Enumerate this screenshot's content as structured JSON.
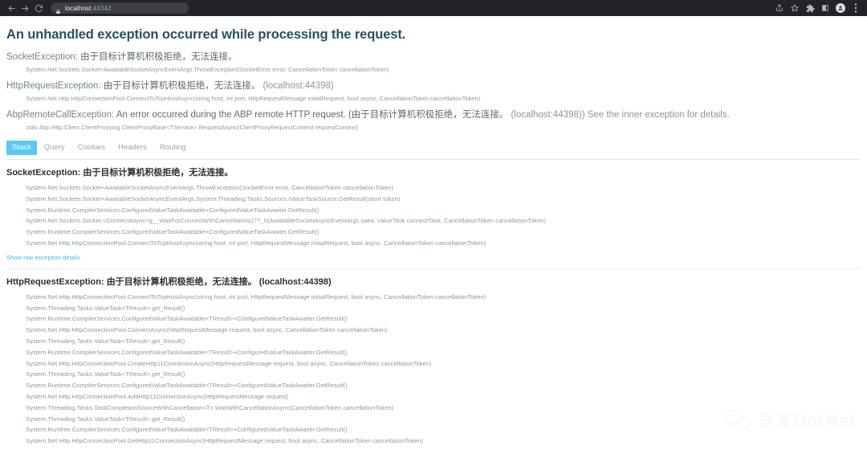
{
  "browser": {
    "back_icon": "arrow-left-icon",
    "forward_icon": "arrow-right-icon",
    "reload_icon": "reload-icon",
    "lock_icon": "lock-icon",
    "url_host": "localhost",
    "url_port": ":44342",
    "right_icons": [
      "share-icon",
      "bookmark-star-icon",
      "extensions-puzzle-icon",
      "side-panel-icon",
      "profile-avatar-icon",
      "browser-menu-icon"
    ]
  },
  "page": {
    "title": "An unhandled exception occurred while processing the request.",
    "summary": [
      {
        "heading_type": "SocketException: ",
        "heading_message": "由于目标计算机积极拒绝，无法连接。",
        "heading_location": "",
        "frame": "System.Net.Sockets.Socket+AwaitableSocketAsyncEventArgs.ThrowException(SocketError error, CancellationToken cancellationToken)"
      },
      {
        "heading_type": "HttpRequestException: ",
        "heading_message": "由于目标计算机积极拒绝，无法连接。",
        "heading_location": " (localhost:44398)",
        "frame": "System.Net.Http.HttpConnectionPool.ConnectToTcpHostAsync(string host, int port, HttpRequestMessage initialRequest, bool async, CancellationToken cancellationToken)"
      },
      {
        "heading_type": "AbpRemoteCallException: ",
        "heading_message": "An error occurred during the ABP remote HTTP request. (由于目标计算机积极拒绝，无法连接。",
        "heading_location": " (localhost:44398)) See the inner exception for details.",
        "frame": "Volo.Abp.Http.Client.ClientProxying.ClientProxyBase<TService>.RequestAsync(ClientProxyRequestContext requestContext)"
      }
    ],
    "tabs": [
      {
        "label": "Stack",
        "active": true
      },
      {
        "label": "Query",
        "active": false
      },
      {
        "label": "Cookies",
        "active": false
      },
      {
        "label": "Headers",
        "active": false
      },
      {
        "label": "Routing",
        "active": false
      }
    ],
    "raw_details_link": "Show raw exception details",
    "exceptions": [
      {
        "type": "SocketException: ",
        "message": "由于目标计算机积极拒绝，无法连接。",
        "location": "",
        "frames": [
          "System.Net.Sockets.Socket+AwaitableSocketAsyncEventArgs.ThrowException(SocketError error, CancellationToken cancellationToken)",
          "System.Net.Sockets.Socket+AwaitableSocketAsyncEventArgs.System.Threading.Tasks.Sources.IValueTaskSource.GetResult(short token)",
          "System.Runtime.CompilerServices.ConfiguredValueTaskAwaitable+ConfiguredValueTaskAwaiter.GetResult()",
          "System.Net.Sockets.Socket.<ConnectAsync>g__WaitForConnectWithCancellation|277_0(AwaitableSocketAsyncEventArgs saea, ValueTask connectTask, CancellationToken cancellationToken)",
          "System.Runtime.CompilerServices.ConfiguredValueTaskAwaitable+ConfiguredValueTaskAwaiter.GetResult()",
          "System.Net.Http.HttpConnectionPool.ConnectToTcpHostAsync(string host, int port, HttpRequestMessage initialRequest, bool async, CancellationToken cancellationToken)"
        ]
      },
      {
        "type": "HttpRequestException: ",
        "message": "由于目标计算机积极拒绝，无法连接。",
        "location": " (localhost:44398)",
        "frames": [
          "System.Net.Http.HttpConnectionPool.ConnectToTcpHostAsync(string host, int port, HttpRequestMessage initialRequest, bool async, CancellationToken cancellationToken)",
          "System.Threading.Tasks.ValueTask<TResult>.get_Result()",
          "System.Runtime.CompilerServices.ConfiguredValueTaskAwaitable<TResult>+ConfiguredValueTaskAwaiter.GetResult()",
          "System.Net.Http.HttpConnectionPool.ConnectAsync(HttpRequestMessage request, bool async, CancellationToken cancellationToken)",
          "System.Threading.Tasks.ValueTask<TResult>.get_Result()",
          "System.Runtime.CompilerServices.ConfiguredValueTaskAwaitable<TResult>+ConfiguredValueTaskAwaiter.GetResult()",
          "System.Net.Http.HttpConnectionPool.CreateHttp11ConnectionAsync(HttpRequestMessage request, bool async, CancellationToken cancellationToken)",
          "System.Threading.Tasks.ValueTask<TResult>.get_Result()",
          "System.Runtime.CompilerServices.ConfiguredValueTaskAwaitable<TResult>+ConfiguredValueTaskAwaiter.GetResult()",
          "System.Net.Http.HttpConnectionPool.AddHttp11ConnectionAsync(HttpRequestMessage request)",
          "System.Threading.Tasks.TaskCompletionSourceWithCancellation<T>.WaitWithCancellationAsync(CancellationToken cancellationToken)",
          "System.Threading.Tasks.ValueTask<TResult>.get_Result()",
          "System.Runtime.CompilerServices.ConfiguredValueTaskAwaitable<TResult>+ConfiguredValueTaskAwaiter.GetResult()",
          "System.Net.Http.HttpConnectionPool.GetHttp11ConnectionAsync(HttpRequestMessage request, bool async, CancellationToken cancellationToken)"
        ]
      }
    ],
    "watermark_text": "吾爱DotNet"
  },
  "colors": {
    "accent_tab": "#5bc8f5",
    "link": "#4db3e0",
    "title": "#2b4f63",
    "chrome_bg": "#232427"
  }
}
